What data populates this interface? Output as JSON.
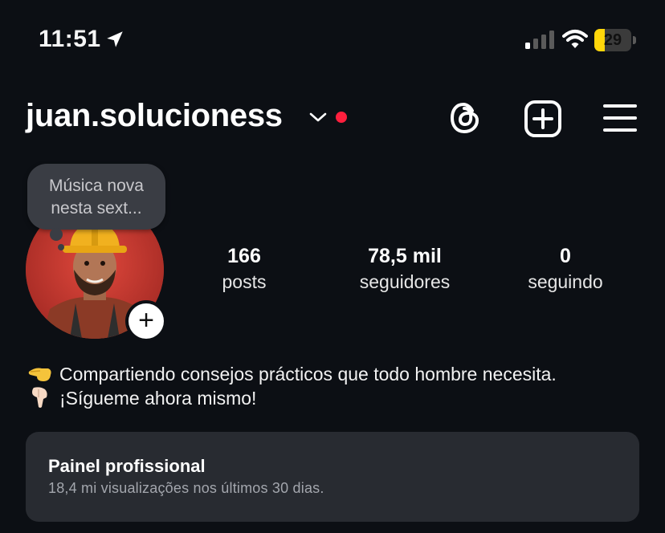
{
  "status_bar": {
    "time": "11:51",
    "battery_level": "29",
    "battery_fraction": 0.29,
    "signal_bars_active": 1,
    "signal_bars_total": 4,
    "accent_battery": "#ffd60a"
  },
  "header": {
    "username": "juan.solucioness",
    "notification_dot_color": "#ff1f3d",
    "icons": [
      "chevron-down-icon",
      "threads-icon",
      "create-plus-icon",
      "menu-icon"
    ]
  },
  "note": {
    "line1": "Música nova",
    "line2": "nesta sext..."
  },
  "stats": {
    "posts": {
      "value": "166",
      "label": "posts"
    },
    "followers": {
      "value": "78,5 mil",
      "label": "seguidores"
    },
    "following": {
      "value": "0",
      "label": "seguindo"
    }
  },
  "bio": {
    "line1": "Compartiendo consejos prácticos que todo hombre necesita.",
    "line2": "¡Sígueme ahora mismo!",
    "line1_emoji": "pointing-left-hand-emoji",
    "line2_emoji": "pointing-down-hand-emoji"
  },
  "dashboard": {
    "title": "Painel profissional",
    "subtitle": "18,4 mi visualizações nos últimos 30 dias."
  }
}
